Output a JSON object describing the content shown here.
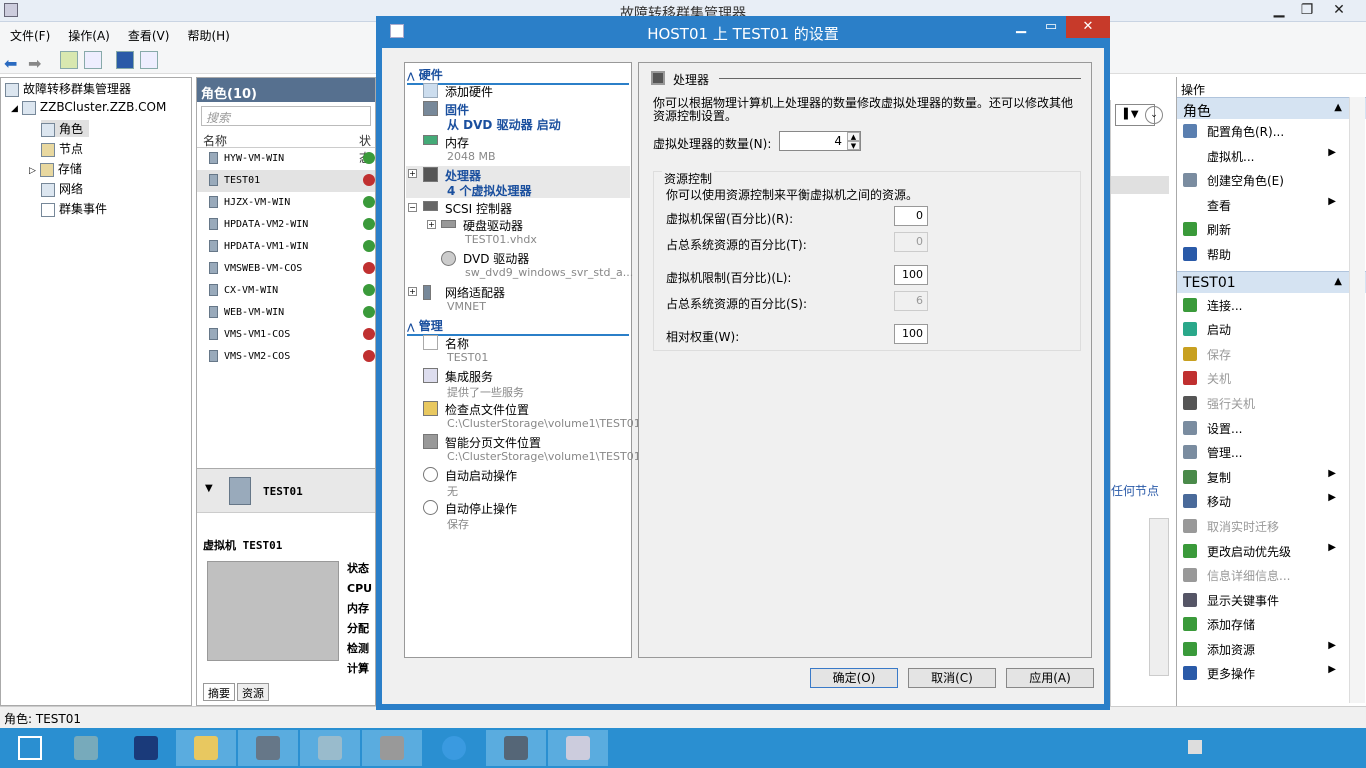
{
  "main": {
    "title": "故障转移群集管理器",
    "menu": [
      "文件(F)",
      "操作(A)",
      "查看(V)",
      "帮助(H)"
    ]
  },
  "tree": {
    "root": "故障转移群集管理器",
    "cluster": "ZZBCluster.ZZB.COM",
    "items": [
      "角色",
      "节点",
      "存储",
      "网络",
      "群集事件"
    ]
  },
  "roles": {
    "header": "角色(10)",
    "search_placeholder": "搜索",
    "col_name": "名称",
    "col_status": "状态",
    "rows": [
      {
        "name": "HYW-VM-WIN",
        "status": "up"
      },
      {
        "name": "TEST01",
        "status": "down"
      },
      {
        "name": "HJZX-VM-WIN",
        "status": "up"
      },
      {
        "name": "HPDATA-VM2-WIN",
        "status": "up"
      },
      {
        "name": "HPDATA-VM1-WIN",
        "status": "up"
      },
      {
        "name": "VMSWEB-VM-COS",
        "status": "down"
      },
      {
        "name": "CX-VM-WIN",
        "status": "up"
      },
      {
        "name": "WEB-VM-WIN",
        "status": "up"
      },
      {
        "name": "VMS-VM1-COS",
        "status": "down"
      },
      {
        "name": "VMS-VM2-COS",
        "status": "down"
      }
    ]
  },
  "detail": {
    "title": "TEST01",
    "vm_label": "虚拟机 TEST01",
    "fields": [
      "状态",
      "CPU",
      "内存",
      "分配",
      "检测",
      "计算"
    ],
    "tabs": [
      "摘要",
      "资源"
    ],
    "right_link": "任何节点"
  },
  "actions": {
    "header": "操作",
    "sec_roles": "角色",
    "roles_items": [
      {
        "label": "配置角色(R)...",
        "icon": "configure-role-icon",
        "arrow": false,
        "disabled": false,
        "color": "#5a7fb0"
      },
      {
        "label": "虚拟机...",
        "icon": "",
        "arrow": true,
        "disabled": false,
        "color": ""
      },
      {
        "label": "创建空角色(E)",
        "icon": "empty-role-icon",
        "arrow": false,
        "disabled": false,
        "color": "#7a8ca0"
      },
      {
        "label": "查看",
        "icon": "",
        "arrow": true,
        "disabled": false,
        "color": ""
      },
      {
        "label": "刷新",
        "icon": "refresh-icon",
        "arrow": false,
        "disabled": false,
        "color": "#3a9a3a"
      },
      {
        "label": "帮助",
        "icon": "help-icon",
        "arrow": false,
        "disabled": false,
        "color": "#2a5aa8"
      }
    ],
    "sec_vm": "TEST01",
    "vm_items": [
      {
        "label": "连接...",
        "icon": "connect-icon",
        "arrow": false,
        "disabled": false,
        "color": "#3a9a3a"
      },
      {
        "label": "启动",
        "icon": "start-icon",
        "arrow": false,
        "disabled": false,
        "color": "#2aa88a"
      },
      {
        "label": "保存",
        "icon": "save-icon",
        "arrow": false,
        "disabled": true,
        "color": "#c8a020"
      },
      {
        "label": "关机",
        "icon": "shutdown-icon",
        "arrow": false,
        "disabled": true,
        "color": "#c03030"
      },
      {
        "label": "强行关机",
        "icon": "turn-off-icon",
        "arrow": false,
        "disabled": true,
        "color": "#555"
      },
      {
        "label": "设置...",
        "icon": "settings-icon",
        "arrow": false,
        "disabled": false,
        "color": "#7a8ca0"
      },
      {
        "label": "管理...",
        "icon": "manage-icon",
        "arrow": false,
        "disabled": false,
        "color": "#7a8ca0"
      },
      {
        "label": "复制",
        "icon": "replicate-icon",
        "arrow": true,
        "disabled": false,
        "color": "#4a8a4a"
      },
      {
        "label": "移动",
        "icon": "move-icon",
        "arrow": true,
        "disabled": false,
        "color": "#4a6a9a"
      },
      {
        "label": "取消实时迁移",
        "icon": "cancel-migration-icon",
        "arrow": false,
        "disabled": true,
        "color": "#999"
      },
      {
        "label": "更改启动优先级",
        "icon": "priority-icon",
        "arrow": true,
        "disabled": false,
        "color": "#3a9a3a"
      },
      {
        "label": "信息详细信息...",
        "icon": "info-icon",
        "arrow": false,
        "disabled": true,
        "color": "#999"
      },
      {
        "label": "显示关键事件",
        "icon": "events-icon",
        "arrow": false,
        "disabled": false,
        "color": "#556"
      },
      {
        "label": "添加存储",
        "icon": "add-storage-icon",
        "arrow": false,
        "disabled": false,
        "color": "#3a9a3a"
      },
      {
        "label": "添加资源",
        "icon": "add-resource-icon",
        "arrow": true,
        "disabled": false,
        "color": "#3a9a3a"
      },
      {
        "label": "更多操作",
        "icon": "more-actions-icon",
        "arrow": true,
        "disabled": false,
        "color": "#2a5aa8"
      }
    ]
  },
  "statusbar": {
    "text": "角色: TEST01"
  },
  "dialog": {
    "title": "HOST01 上 TEST01 的设置",
    "nav": {
      "hardware": "硬件",
      "add_hardware": "添加硬件",
      "firmware": "固件",
      "firmware_sub": "从 DVD 驱动器 启动",
      "memory": "内存",
      "memory_sub": "2048 MB",
      "processor": "处理器",
      "processor_sub": "4 个虚拟处理器",
      "scsi": "SCSI 控制器",
      "hdd": "硬盘驱动器",
      "hdd_sub": "TEST01.vhdx",
      "dvd": "DVD 驱动器",
      "dvd_sub": "sw_dvd9_windows_svr_std_a...",
      "nic": "网络适配器",
      "nic_sub": "VMNET",
      "management": "管理",
      "name": "名称",
      "name_sub": "TEST01",
      "integration": "集成服务",
      "integration_sub": "提供了一些服务",
      "checkpoint": "检查点文件位置",
      "checkpoint_sub": "C:\\ClusterStorage\\volume1\\TEST01",
      "paging": "智能分页文件位置",
      "paging_sub": "C:\\ClusterStorage\\volume1\\TEST01",
      "autostart": "自动启动操作",
      "autostart_sub": "无",
      "autostop": "自动停止操作",
      "autostop_sub": "保存"
    },
    "panel": {
      "title": "处理器",
      "desc": "你可以根据物理计算机上处理器的数量修改虚拟处理器的数量。还可以修改其他资源控制设置。",
      "count_label": "虚拟处理器的数量(N):",
      "count_value": "4",
      "rc_title": "资源控制",
      "rc_desc": "你可以使用资源控制来平衡虚拟机之间的资源。",
      "reserve_label": "虚拟机保留(百分比)(R):",
      "reserve_value": "0",
      "reserve_total_label": "占总系统资源的百分比(T):",
      "reserve_total_value": "0",
      "limit_label": "虚拟机限制(百分比)(L):",
      "limit_value": "100",
      "limit_total_label": "占总系统资源的百分比(S):",
      "limit_total_value": "6",
      "weight_label": "相对权重(W):",
      "weight_value": "100"
    },
    "buttons": {
      "ok": "确定(O)",
      "cancel": "取消(C)",
      "apply": "应用(A)"
    }
  },
  "taskbar": {
    "apps": [
      "start-button",
      "server-manager",
      "powershell",
      "explorer",
      "hyper-v-manager",
      "failover-cluster-manager",
      "tools",
      "internet-explorer",
      "remote-desktop",
      "task-manager"
    ]
  }
}
